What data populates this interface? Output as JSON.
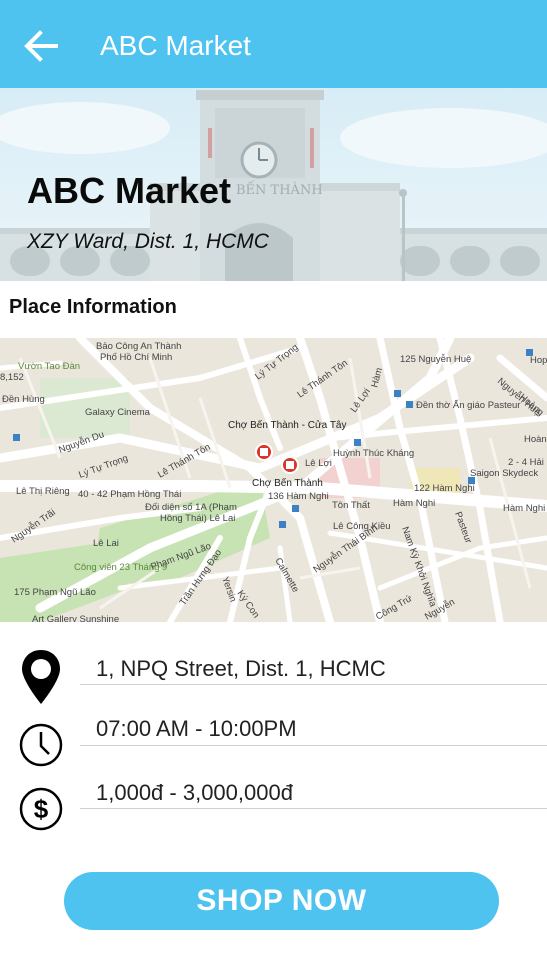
{
  "appbar": {
    "title": "ABC Market",
    "back_icon": "arrow-left-icon"
  },
  "hero": {
    "name": "ABC Market",
    "address": "XZY Ward, Dist. 1, HCMC",
    "sign_text": "BẾN THÀNH"
  },
  "section": {
    "title": "Place Information"
  },
  "map": {
    "labels": [
      "Bảo Công An Thành",
      "Phố Hồ Chí Minh",
      "Vườn Tao Đàn",
      "8,152",
      "Đền Hùng",
      "Galaxy Cinema",
      "Nguyễn Du",
      "Lý Tự Trọng",
      "Lý Tự Trọng",
      "Lê Thánh Tôn",
      "Lê Thánh Tôn",
      "Chợ Bến Thành - Cửa Tây",
      "Chợ Bến Thành",
      "Lê Lợi",
      "Lê Lợi",
      "125 Nguyễn Huệ",
      "Đền thờ Ấn giáo Pasteur",
      "Hàm Nghi",
      "Hàm Nghi",
      "Huỳnh Thúc Kháng",
      "122 Hàm Nghi",
      "136 Hàm Nghi",
      "Lê Thị Riêng",
      "40 - 42 Phạm Hồng Thái",
      "Đối diện số 1A (Phạm",
      "Hồng Thái) Lê Lai",
      "Lê Công Kiều",
      "Nguyễn Thái Bình",
      "Nam Kỳ Khởi Nghĩa",
      "Pasteur",
      "Calmette",
      "Yersin",
      "Ký Con",
      "Trần Hưng Đạo",
      "Phạm Ngũ Lão",
      "Lê Lai",
      "Công viên 23 Tháng 9",
      "175 Phạm Ngũ Lão",
      "Art Gallery Sunshine",
      "Nguyễn Trãi",
      "Saigon Skydeck",
      "2 - 4 Hải",
      "Hoàng",
      "Nguyễn Huệ",
      "Hoàng",
      "Hope",
      "Tôn Thất",
      "Công Trứ",
      "Hàm",
      "Nguyễn"
    ]
  },
  "info": {
    "address": "1, NPQ Street, Dist. 1, HCMC",
    "hours": "07:00 AM - 10:00PM",
    "price": "1,000đ - 3,000,000đ",
    "address_icon": "map-pin-icon",
    "hours_icon": "clock-icon",
    "price_icon": "dollar-icon"
  },
  "actions": {
    "shop_now": "SHOP NOW"
  },
  "colors": {
    "accent": "#4fc3f0",
    "pin": "#d9352b",
    "park": "#c7e3b4"
  }
}
